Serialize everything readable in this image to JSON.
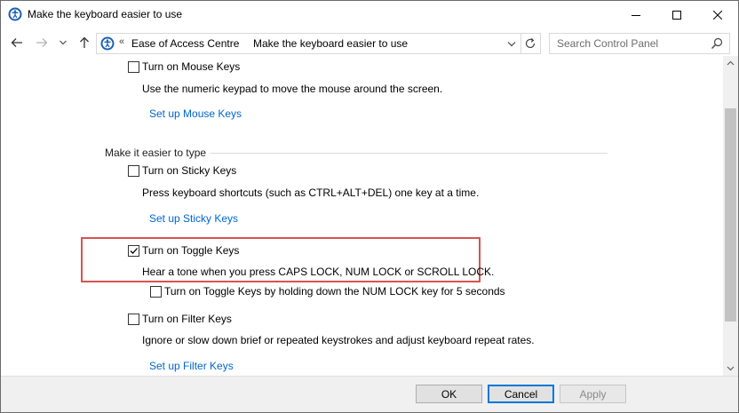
{
  "window": {
    "title": "Make the keyboard easier to use"
  },
  "address": {
    "overflow": "«",
    "crumbs": [
      "Ease of Access Centre",
      "Make the keyboard easier to use"
    ]
  },
  "search": {
    "placeholder": "Search Control Panel"
  },
  "mouse_keys": {
    "label": "Turn on Mouse Keys",
    "checked": false,
    "description": "Use the numeric keypad to move the mouse around the screen.",
    "setup_link": "Set up Mouse Keys"
  },
  "section": {
    "heading": "Make it easier to type"
  },
  "sticky_keys": {
    "label": "Turn on Sticky Keys",
    "checked": false,
    "description": "Press keyboard shortcuts (such as CTRL+ALT+DEL) one key at a time.",
    "setup_link": "Set up Sticky Keys"
  },
  "toggle_keys": {
    "label": "Turn on Toggle Keys",
    "checked": true,
    "description": "Hear a tone when you press CAPS LOCK, NUM LOCK or SCROLL LOCK.",
    "sub_option": {
      "label": "Turn on Toggle Keys by holding down the NUM LOCK key for 5 seconds",
      "checked": false
    }
  },
  "filter_keys": {
    "label": "Turn on Filter Keys",
    "checked": false,
    "description": "Ignore or slow down brief or repeated keystrokes and adjust keyboard repeat rates.",
    "setup_link": "Set up Filter Keys"
  },
  "footer": {
    "ok_label": "OK",
    "cancel_label": "Cancel",
    "apply_label": "Apply"
  },
  "colors": {
    "link": "#0066cc",
    "highlight_border": "#d9534f",
    "focus_border": "#0078d7"
  }
}
